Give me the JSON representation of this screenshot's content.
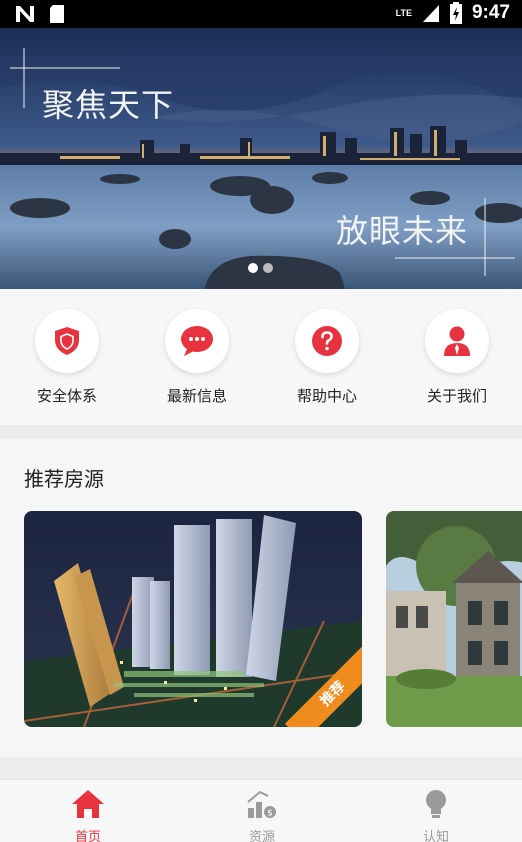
{
  "status_bar": {
    "time": "9:47",
    "network": "LTE"
  },
  "banner": {
    "text_top": "聚焦天下",
    "text_bottom": "放眼未来",
    "page_count": 2,
    "active_page": 1
  },
  "quick_links": [
    {
      "label": "安全体系",
      "icon": "shield-icon"
    },
    {
      "label": "最新信息",
      "icon": "chat-icon"
    },
    {
      "label": "帮助中心",
      "icon": "question-icon"
    },
    {
      "label": "关于我们",
      "icon": "person-icon"
    }
  ],
  "recommend": {
    "title": "推荐房源",
    "cards": [
      {
        "tag": "推荐",
        "image": "night-city-towers-photo"
      },
      {
        "tag": "",
        "image": "villa-photo"
      }
    ]
  },
  "bottom_nav": [
    {
      "label": "首页",
      "icon": "home-icon",
      "active": true
    },
    {
      "label": "资源",
      "icon": "resource-icon",
      "active": false
    },
    {
      "label": "认知",
      "icon": "lightbulb-icon",
      "active": false
    }
  ],
  "colors": {
    "accent": "#e8323e",
    "tag": "#f08b1e",
    "inactive": "#9a9a9a"
  }
}
